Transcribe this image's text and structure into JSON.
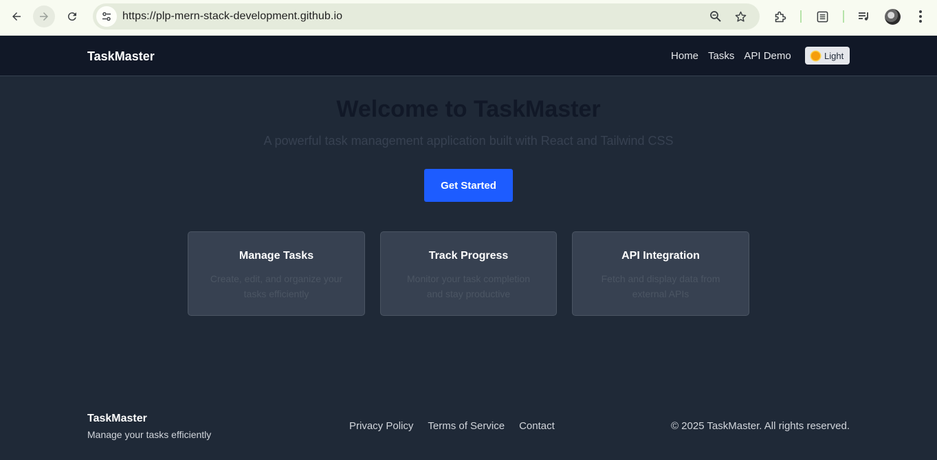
{
  "browser": {
    "url": "https://plp-mern-stack-development.github.io",
    "icons": {
      "back": "arrow-left-icon",
      "forward": "arrow-right-icon",
      "reload": "reload-icon",
      "site_info": "tune-icon",
      "zoom": "zoom-icon",
      "bookmark": "star-icon",
      "extensions": "puzzle-icon",
      "reading_list": "reading-list-icon",
      "media": "media-controls-icon",
      "menu": "kebab-menu-icon"
    }
  },
  "header": {
    "brand": "TaskMaster",
    "nav": [
      "Home",
      "Tasks",
      "API Demo"
    ],
    "theme_toggle": "Light"
  },
  "hero": {
    "title": "Welcome to TaskMaster",
    "subtitle": "A powerful task management application built with React and Tailwind CSS",
    "cta": "Get Started"
  },
  "features": [
    {
      "title": "Manage Tasks",
      "description": "Create, edit, and organize your tasks efficiently"
    },
    {
      "title": "Track Progress",
      "description": "Monitor your task completion and stay productive"
    },
    {
      "title": "API Integration",
      "description": "Fetch and display data from external APIs"
    }
  ],
  "footer": {
    "brand": "TaskMaster",
    "tagline": "Manage your tasks efficiently",
    "links": [
      "Privacy Policy",
      "Terms of Service",
      "Contact"
    ],
    "copyright": "© 2025 TaskMaster. All rights reserved."
  },
  "colors": {
    "header_bg": "#111827",
    "page_bg": "#1f2937",
    "card_bg": "#374151",
    "accent": "#1d5cff"
  }
}
